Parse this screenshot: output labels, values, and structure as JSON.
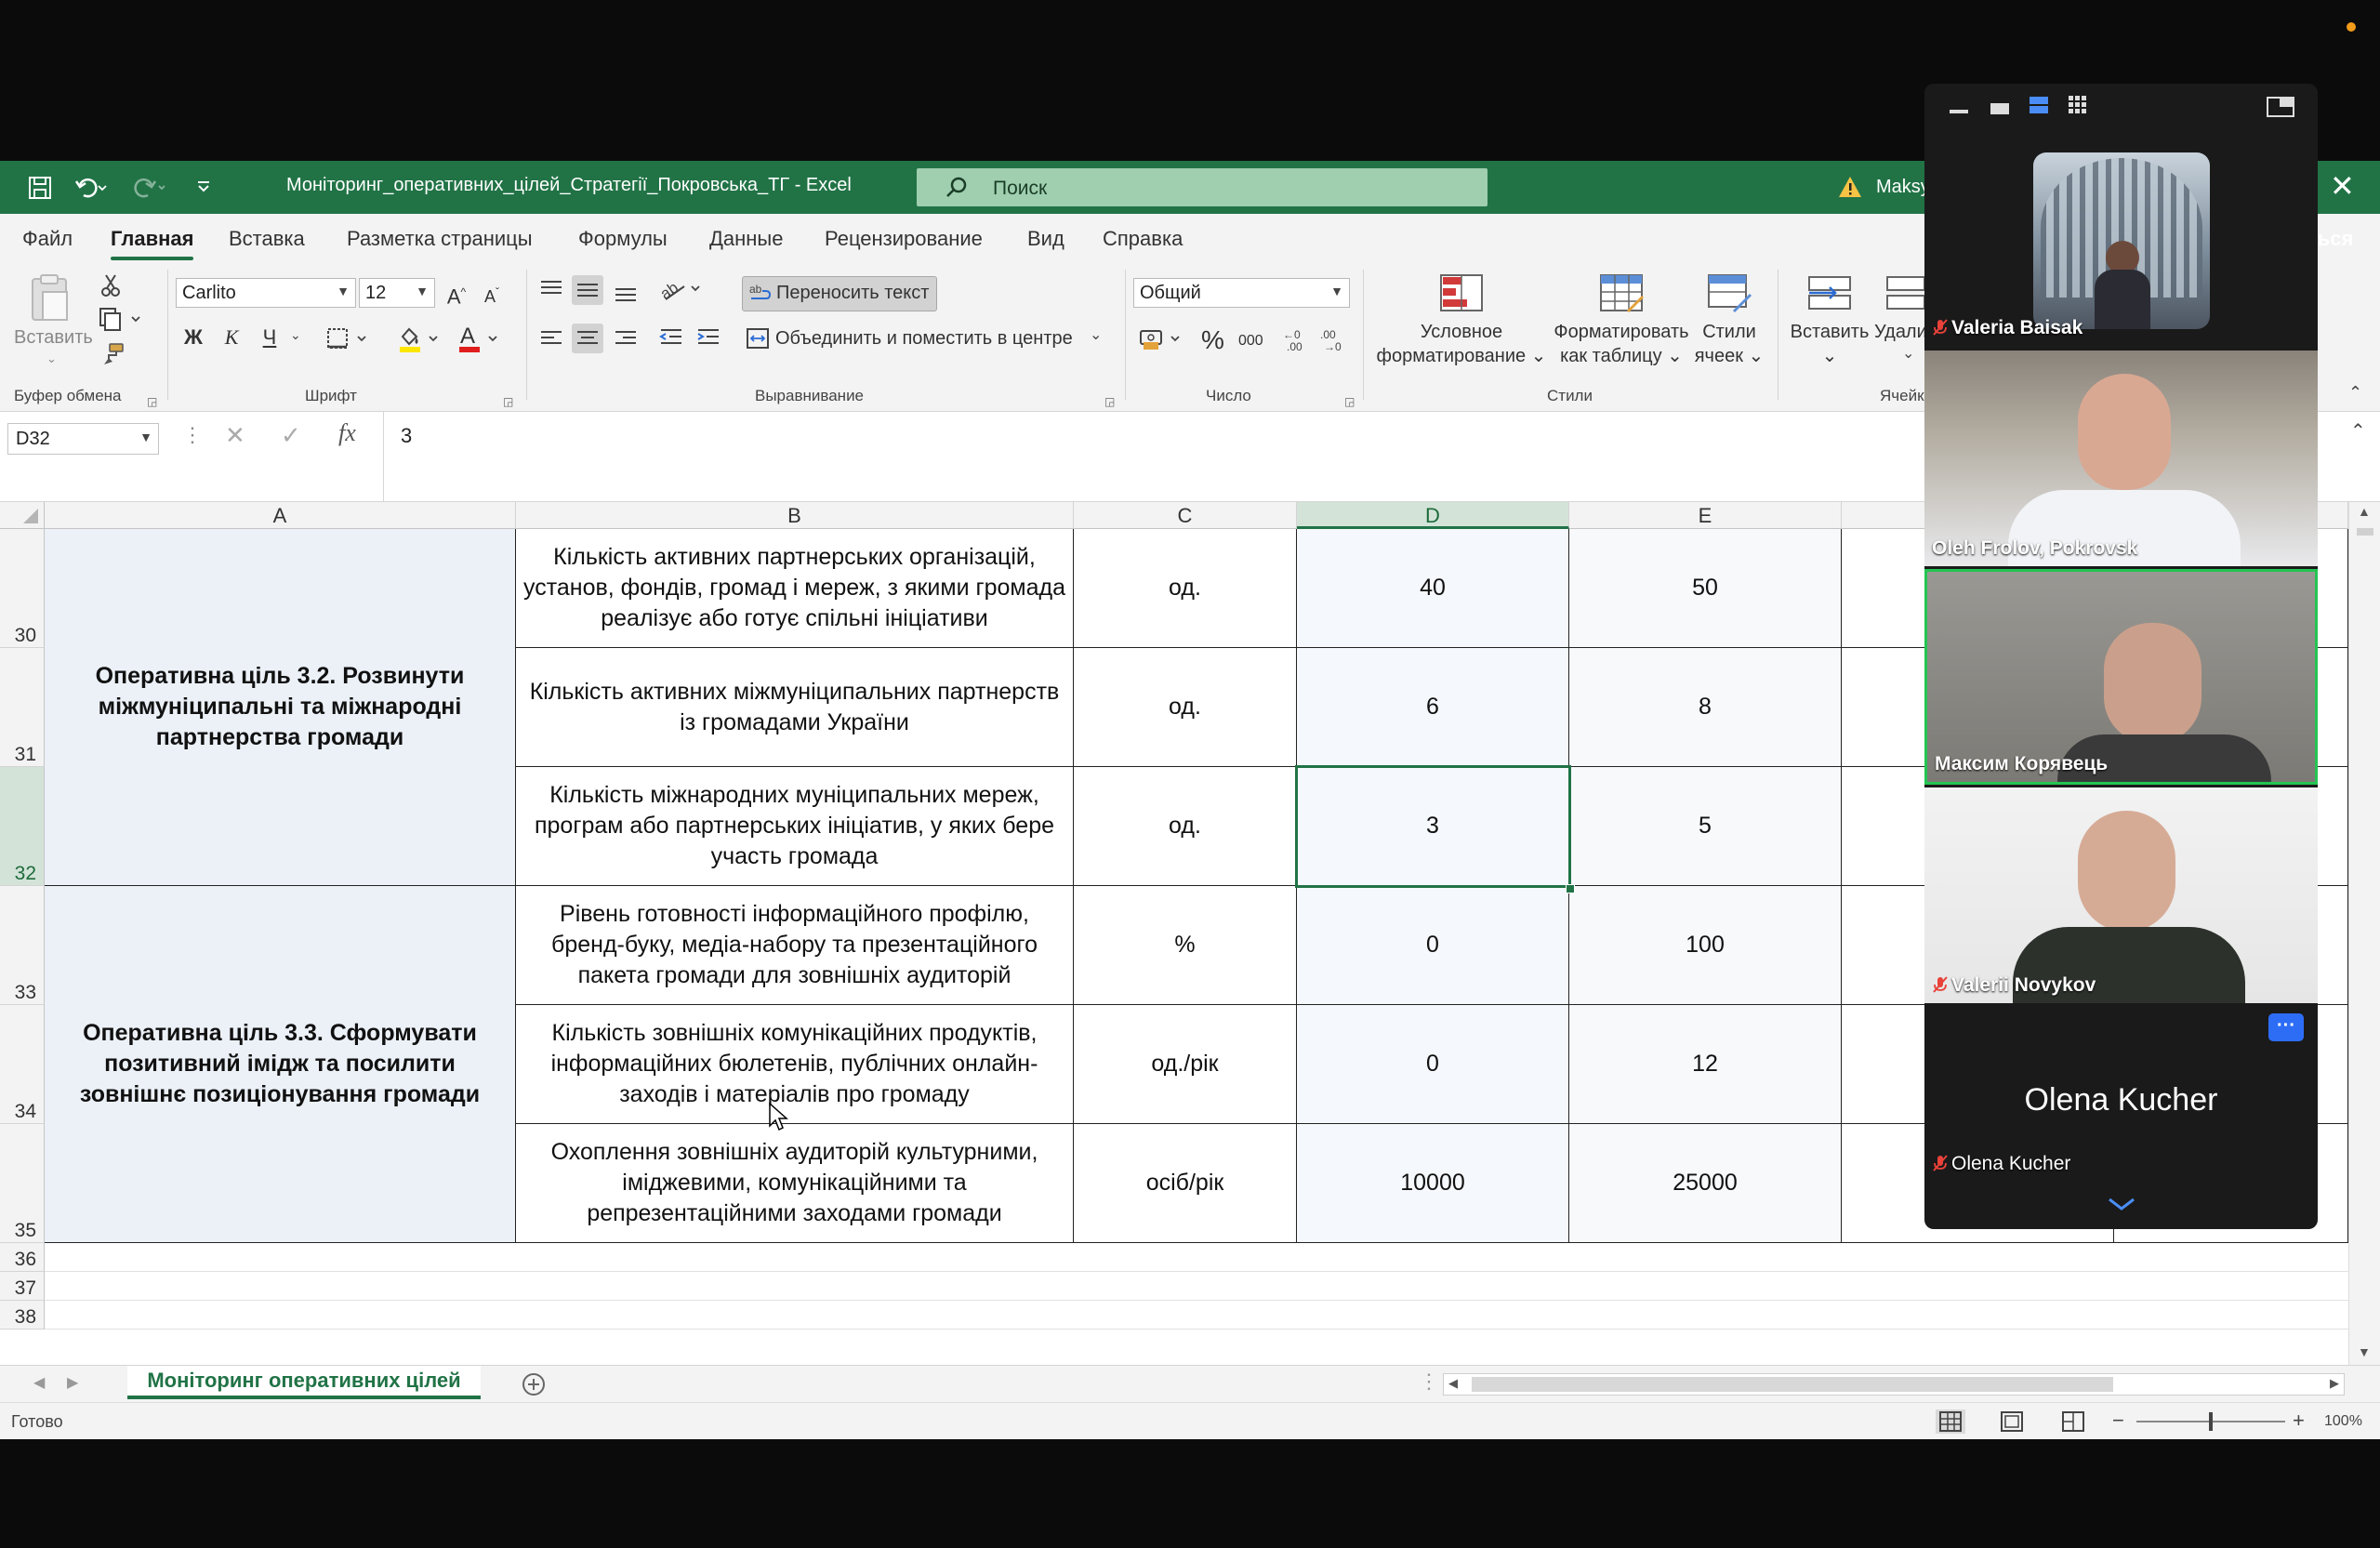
{
  "excel": {
    "window_title": "Моніторинг_оперативних_цілей_Стратегії_Покровська_ТГ  -  Excel",
    "search_placeholder": "Поиск",
    "user_partial": "Maksy",
    "signin_partial": "ться",
    "menu": [
      "Файл",
      "Главная",
      "Вставка",
      "Разметка страницы",
      "Формулы",
      "Данные",
      "Рецензирование",
      "Вид",
      "Справка"
    ],
    "active_menu": "Главная",
    "ribbon": {
      "paste": "Вставить",
      "clipboard_group": "Буфер обмена",
      "font_name": "Carlito",
      "font_size": "12",
      "font_group": "Шрифт",
      "bold": "Ж",
      "italic": "К",
      "underline": "Ч",
      "wrap_text": "Переносить текст",
      "merge_center": "Объединить и поместить в центре",
      "alignment_group": "Выравнивание",
      "number_format": "Общий",
      "number_group": "Число",
      "percent": "%",
      "thousands": "000",
      "cond_format_1": "Условное",
      "cond_format_2": "форматирование",
      "format_table_1": "Форматировать",
      "format_table_2": "как таблицу",
      "cell_styles_1": "Стили",
      "cell_styles_2": "ячеек",
      "styles_group": "Стили",
      "insert": "Вставить",
      "delete_partial": "Удали",
      "cells_group_partial": "Ячейк"
    },
    "name_box": "D32",
    "formula_value": "3",
    "columns": [
      "A",
      "B",
      "C",
      "D",
      "E"
    ],
    "rows": [
      {
        "num": "30",
        "b": "Кількість активних партнерських організацій, установ, фондів, громад і мереж, з якими громада реалізує або готує спільні ініціативи",
        "c": "од.",
        "d": "40",
        "e": "50"
      },
      {
        "num": "31",
        "b": "Кількість активних міжмуніципальних партнерств із громадами України",
        "c": "од.",
        "d": "6",
        "e": "8"
      },
      {
        "num": "32",
        "b": "Кількість міжнародних муніципальних мереж, програм або партнерських ініціатив, у яких бере участь громада",
        "c": "од.",
        "d": "3",
        "e": "5"
      },
      {
        "num": "33",
        "b": "Рівень готовності інформаційного профілю, бренд-буку, медіа-набору та презентаційного пакета громади для зовнішніх аудиторій",
        "c": "%",
        "d": "0",
        "e": "100"
      },
      {
        "num": "34",
        "b": "Кількість зовнішніх комунікаційних продуктів, інформаційних бюлетенів, публічних онлайн-заходів і матеріалів про громаду",
        "c": "од./рік",
        "d": "0",
        "e": "12"
      },
      {
        "num": "35",
        "b": "Охоплення зовнішніх аудиторій культурними, іміджевими, комунікаційними та репрезентаційними заходами громади",
        "c": "осіб/рік",
        "d": "10000",
        "e": "25000"
      }
    ],
    "goal_1": "Оперативна ціль 3.2. Розвинути міжмуніципальні та міжнародні партнерства громади",
    "goal_2": "Оперативна ціль 3.3. Сформувати позитивний імідж та посилити зовнішнє позиціонування громади",
    "empty_rows": [
      "36",
      "37",
      "38"
    ],
    "sheet_tab": "Моніторинг оперативних цілей",
    "status": "Готово",
    "zoom_level": "100%"
  },
  "zoom_panel": {
    "participants": [
      {
        "name": "Valeria Baisak",
        "muted": true
      },
      {
        "name": "Oleh Frolov, Pokrovsk",
        "muted": false
      },
      {
        "name": "Максим Корявець",
        "muted": false,
        "speaking": true
      },
      {
        "name": "Valerii Novykov",
        "muted": true
      },
      {
        "name": "Olena Kucher",
        "muted": true,
        "video_off": true,
        "display_name": "Olena Kucher"
      }
    ],
    "more_label": "···"
  },
  "colors": {
    "excel_green": "#217346",
    "active_speaker": "#23c552",
    "zoom_bg": "#1a1a1a"
  }
}
